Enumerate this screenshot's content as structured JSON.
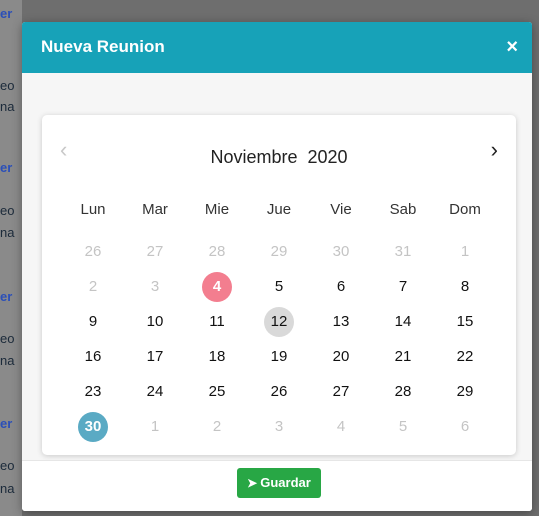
{
  "background": {
    "snippets": [
      {
        "text": "er",
        "style": "link"
      },
      {
        "text": "eo",
        "style": "text"
      },
      {
        "text": "na",
        "style": "text"
      },
      {
        "text": "er",
        "style": "link"
      },
      {
        "text": "eo",
        "style": "text"
      },
      {
        "text": "na",
        "style": "text"
      },
      {
        "text": "er",
        "style": "link"
      },
      {
        "text": "eo",
        "style": "text"
      },
      {
        "text": "na",
        "style": "text"
      },
      {
        "text": "er",
        "style": "link"
      },
      {
        "text": "eo",
        "style": "text"
      },
      {
        "text": "na",
        "style": "text"
      }
    ]
  },
  "modal": {
    "title": "Nueva Reunion",
    "close_label": "×",
    "header_color": "#17a2b8"
  },
  "calendar": {
    "prev_icon": "‹",
    "next_icon": "›",
    "month": "Noviembre",
    "year": "2020",
    "weekdays": [
      "Lun",
      "Mar",
      "Mie",
      "Jue",
      "Vie",
      "Sab",
      "Dom"
    ],
    "weeks": [
      [
        {
          "d": "26",
          "muted": true
        },
        {
          "d": "27",
          "muted": true
        },
        {
          "d": "28",
          "muted": true
        },
        {
          "d": "29",
          "muted": true
        },
        {
          "d": "30",
          "muted": true
        },
        {
          "d": "31",
          "muted": true
        },
        {
          "d": "1",
          "muted": true
        }
      ],
      [
        {
          "d": "2",
          "muted": true
        },
        {
          "d": "3",
          "muted": true
        },
        {
          "d": "4",
          "hl": "pink"
        },
        {
          "d": "5"
        },
        {
          "d": "6"
        },
        {
          "d": "7"
        },
        {
          "d": "8"
        }
      ],
      [
        {
          "d": "9"
        },
        {
          "d": "10"
        },
        {
          "d": "11"
        },
        {
          "d": "12",
          "hl": "gray"
        },
        {
          "d": "13"
        },
        {
          "d": "14"
        },
        {
          "d": "15"
        }
      ],
      [
        {
          "d": "16"
        },
        {
          "d": "17"
        },
        {
          "d": "18"
        },
        {
          "d": "19"
        },
        {
          "d": "20"
        },
        {
          "d": "21"
        },
        {
          "d": "22"
        }
      ],
      [
        {
          "d": "23"
        },
        {
          "d": "24"
        },
        {
          "d": "25"
        },
        {
          "d": "26"
        },
        {
          "d": "27"
        },
        {
          "d": "28"
        },
        {
          "d": "29"
        }
      ],
      [
        {
          "d": "30",
          "hl": "blue"
        },
        {
          "d": "1",
          "muted": true
        },
        {
          "d": "2",
          "muted": true
        },
        {
          "d": "3",
          "muted": true
        },
        {
          "d": "4",
          "muted": true
        },
        {
          "d": "5",
          "muted": true
        },
        {
          "d": "6",
          "muted": true
        }
      ]
    ],
    "highlight_colors": {
      "pink": "#f37e8f",
      "gray": "#d9d9d9",
      "blue": "#5aaac4"
    }
  },
  "footer": {
    "save_label": "Guardar",
    "save_icon": "paper-plane-icon",
    "save_color": "#28a745"
  }
}
